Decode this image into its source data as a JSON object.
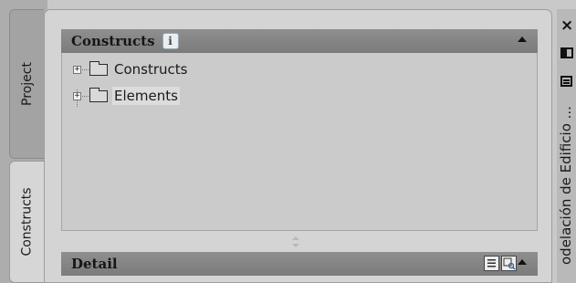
{
  "side_tabs": [
    {
      "label": "Project"
    },
    {
      "label": "Constructs"
    }
  ],
  "constructs_panel": {
    "title": "Constructs",
    "info_glyph": "i",
    "tree": [
      {
        "label": "Constructs",
        "expander": "+"
      },
      {
        "label": "Elements",
        "expander": "+"
      }
    ]
  },
  "detail_panel": {
    "title": "Detail"
  },
  "palette": {
    "title": "odelación de Edificio ...",
    "close_glyph": "×"
  },
  "icons": [
    "info-icon",
    "collapse-icon",
    "folder-icon",
    "expander-icon",
    "splitter-icon",
    "list-view-icon",
    "preview-icon",
    "close-icon",
    "dock-icon",
    "properties-icon"
  ]
}
